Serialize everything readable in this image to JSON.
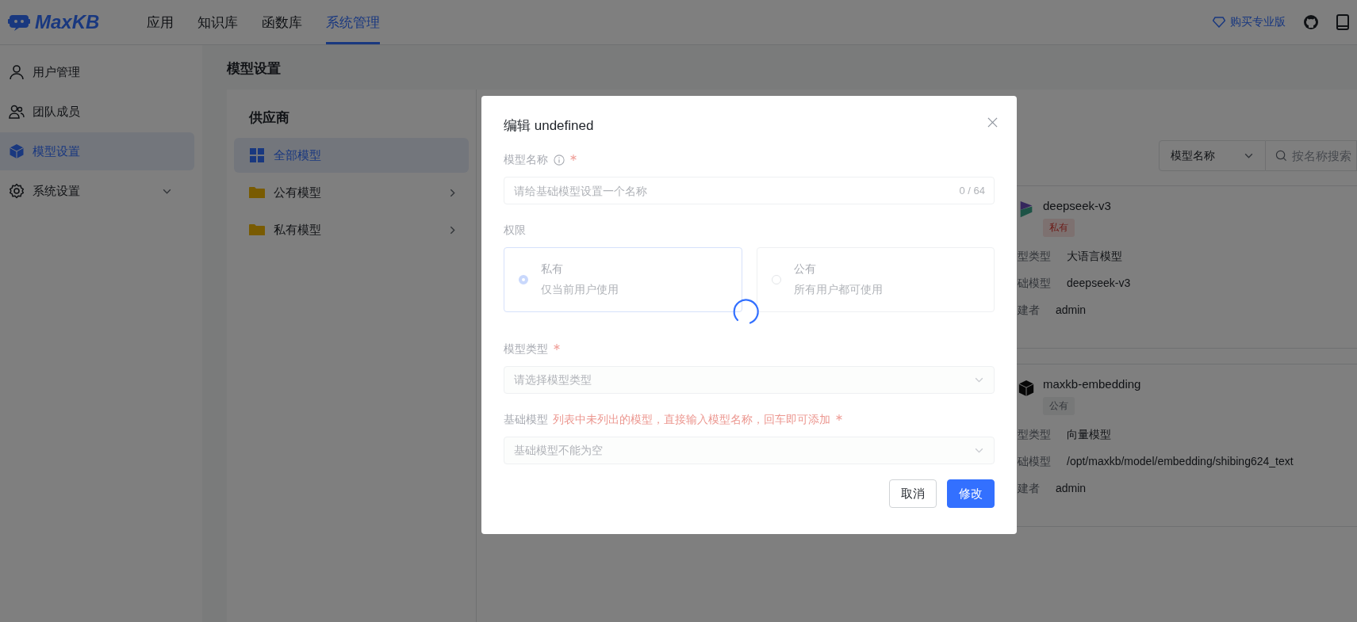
{
  "header": {
    "logo": "MaxKB",
    "nav": [
      {
        "label": "应用",
        "selected": false
      },
      {
        "label": "知识库",
        "selected": false
      },
      {
        "label": "函数库",
        "selected": false
      },
      {
        "label": "系统管理",
        "selected": true
      }
    ],
    "upgrade": "购买专业版"
  },
  "sidebar": {
    "items": [
      {
        "label": "用户管理",
        "selected": false,
        "expandable": false
      },
      {
        "label": "团队成员",
        "selected": false,
        "expandable": false
      },
      {
        "label": "模型设置",
        "selected": true,
        "expandable": false
      },
      {
        "label": "系统设置",
        "selected": false,
        "expandable": true
      }
    ]
  },
  "page_title": "模型设置",
  "providers": {
    "title": "供应商",
    "items": [
      {
        "label": "全部模型",
        "selected": true,
        "expandable": false
      },
      {
        "label": "公有模型",
        "selected": false,
        "expandable": true
      },
      {
        "label": "私有模型",
        "selected": false,
        "expandable": true
      }
    ]
  },
  "filter": {
    "select": "模型名称",
    "search_placeholder": "按名称搜索"
  },
  "models": [
    {
      "name": "deepseek-v3",
      "tag": {
        "label": "私有",
        "kind": "private"
      },
      "fields": [
        {
          "label": "型类型",
          "value": "大语言模型"
        },
        {
          "label": "础模型",
          "value": "deepseek-v3"
        },
        {
          "label": "建者",
          "value": "admin"
        }
      ]
    },
    {
      "name": "maxkb-embedding",
      "tag": {
        "label": "公有",
        "kind": "public"
      },
      "fields": [
        {
          "label": "型类型",
          "value": "向量模型"
        },
        {
          "label": "础模型",
          "value": "/opt/maxkb/model/embedding/shibing624_text"
        },
        {
          "label": "建者",
          "value": "admin"
        }
      ]
    }
  ],
  "dialog": {
    "title": "编辑 undefined",
    "loading": true,
    "name_field": {
      "label": "模型名称",
      "required": true,
      "placeholder": "请给基础模型设置一个名称",
      "counter": "0 / 64"
    },
    "permission": {
      "label": "权限",
      "options": [
        {
          "title": "私有",
          "description": "仅当前用户使用",
          "selected": true
        },
        {
          "title": "公有",
          "description": "所有用户都可使用",
          "selected": false
        }
      ]
    },
    "type_field": {
      "label": "模型类型",
      "required": true,
      "placeholder": "请选择模型类型"
    },
    "base_field": {
      "label": "基础模型",
      "hint": "列表中未列出的模型，直接输入模型名称，回车即可添加",
      "required": true,
      "placeholder": "基础模型不能为空"
    },
    "buttons": [
      {
        "label": "取消",
        "kind": "secondary"
      },
      {
        "label": "修改",
        "kind": "primary"
      }
    ]
  }
}
